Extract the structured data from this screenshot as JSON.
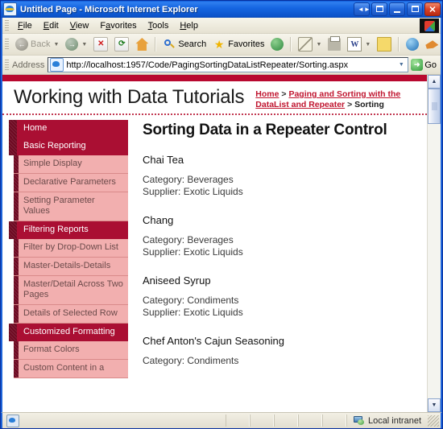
{
  "window": {
    "title": "Untitled Page - Microsoft Internet Explorer",
    "icon": "ie-page-icon",
    "buttons": [
      {
        "name": "restore-group-button",
        "glyph": "◄►"
      },
      {
        "name": "window-group-button",
        "glyph": "⊡"
      },
      {
        "name": "minimize-button",
        "glyph": "_"
      },
      {
        "name": "maximize-button",
        "glyph": "□"
      },
      {
        "name": "close-button",
        "glyph": "✕"
      }
    ]
  },
  "menubar": {
    "items": [
      {
        "pre": "",
        "accel": "F",
        "post": "ile"
      },
      {
        "pre": "",
        "accel": "E",
        "post": "dit"
      },
      {
        "pre": "",
        "accel": "V",
        "post": "iew"
      },
      {
        "pre": "F",
        "accel": "a",
        "post": "vorites"
      },
      {
        "pre": "",
        "accel": "T",
        "post": "ools"
      },
      {
        "pre": "",
        "accel": "H",
        "post": "elp"
      }
    ]
  },
  "toolbar": {
    "back_label": "Back",
    "search_label": "Search",
    "favorites_label": "Favorites",
    "icons": {
      "back": "back-arrow-icon",
      "forward": "forward-arrow-icon",
      "stop": "stop-icon",
      "refresh": "refresh-icon",
      "home": "home-icon",
      "search": "search-icon",
      "favorites": "star-icon",
      "history": "history-icon",
      "mail": "mail-icon",
      "print": "print-icon",
      "edit": "edit-word-icon",
      "notes": "notes-icon",
      "msn": "msn-icon",
      "messenger": "messenger-icon",
      "research": "research-icon",
      "grid": "grid-icon"
    }
  },
  "address": {
    "label": "Address",
    "url": "http://localhost:1957/Code/PagingSortingDataListRepeater/Sorting.aspx",
    "placeholder": "",
    "go_label": "Go",
    "dropdown_glyph": "▼"
  },
  "page": {
    "site_title": "Working with Data Tutorials",
    "breadcrumb": {
      "home": "Home",
      "sep1": " > ",
      "parent": "Paging and Sorting with the DataList and Repeater",
      "sep2": " > ",
      "current": "Sorting"
    },
    "heading": "Sorting Data in a Repeater Control",
    "sidebar": [
      {
        "type": "head",
        "label": "Home"
      },
      {
        "type": "head",
        "label": "Basic Reporting"
      },
      {
        "type": "sub",
        "label": "Simple Display"
      },
      {
        "type": "sub",
        "label": "Declarative Parameters"
      },
      {
        "type": "sub",
        "label": "Setting Parameter Values"
      },
      {
        "type": "head",
        "label": "Filtering Reports"
      },
      {
        "type": "sub",
        "label": "Filter by Drop-Down List"
      },
      {
        "type": "sub",
        "label": "Master-Details-Details"
      },
      {
        "type": "sub",
        "label": "Master/Detail Across Two Pages"
      },
      {
        "type": "sub",
        "label": "Details of Selected Row"
      },
      {
        "type": "head",
        "label": "Customized Formatting"
      },
      {
        "type": "sub",
        "label": "Format Colors"
      },
      {
        "type": "sub",
        "label": "Custom Content in a"
      }
    ],
    "products": [
      {
        "name": "Chai Tea",
        "category": "Category: Beverages",
        "supplier": "Supplier: Exotic Liquids"
      },
      {
        "name": "Chang",
        "category": "Category: Beverages",
        "supplier": "Supplier: Exotic Liquids"
      },
      {
        "name": "Aniseed Syrup",
        "category": "Category: Condiments",
        "supplier": "Supplier: Exotic Liquids"
      },
      {
        "name": "Chef Anton's Cajun Seasoning",
        "category": "Category: Condiments",
        "supplier": ""
      }
    ]
  },
  "scrollbar": {
    "up_glyph": "▲",
    "down_glyph": "▼"
  },
  "statusbar": {
    "message": "",
    "zone": "Local intranet",
    "zone_icon": "local-intranet-icon"
  },
  "colors": {
    "brand_red": "#AA0F33",
    "brand_dark": "#6E0A22",
    "brand_pink": "#F2AFAF",
    "top_bar": "#B8082F",
    "link_red": "#C0152F"
  }
}
